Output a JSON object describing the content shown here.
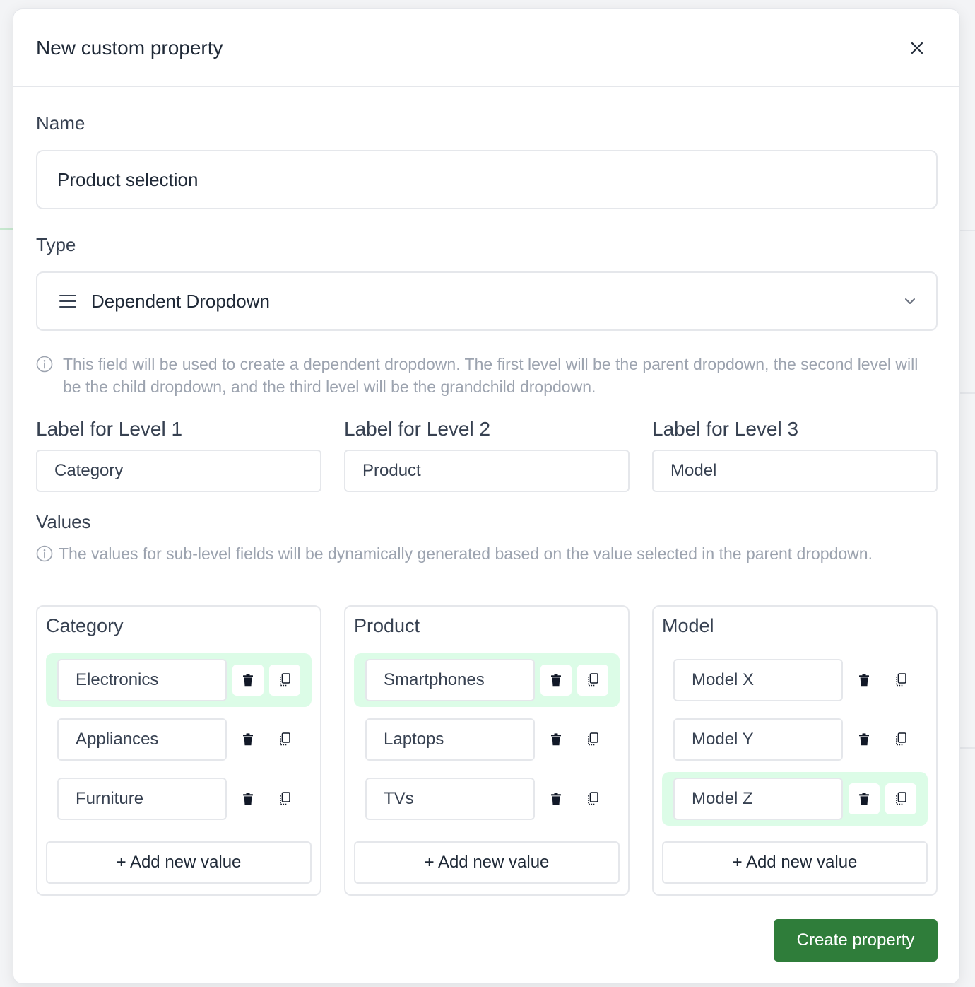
{
  "dialog": {
    "title": "New custom property",
    "create_label": "Create property"
  },
  "name_field": {
    "label": "Name",
    "value": "Product selection"
  },
  "type_field": {
    "label": "Type",
    "value": "Dependent Dropdown",
    "help": "This field will be used to create a dependent dropdown. The first level will be the parent dropdown, the second level will be the child dropdown, and the third level will be the grandchild dropdown."
  },
  "levels": [
    {
      "label": "Label for Level 1",
      "value": "Category"
    },
    {
      "label": "Label for Level 2",
      "value": "Product"
    },
    {
      "label": "Label for Level 3",
      "value": "Model"
    }
  ],
  "values_section": {
    "title": "Values",
    "help": "The values for sub-level fields will be dynamically generated based on the value selected in the parent dropdown.",
    "add_label": "+ Add new value"
  },
  "columns": [
    {
      "title": "Category",
      "selected_index": 0,
      "items": [
        "Electronics",
        "Appliances",
        "Furniture"
      ]
    },
    {
      "title": "Product",
      "selected_index": 0,
      "items": [
        "Smartphones",
        "Laptops",
        "TVs"
      ]
    },
    {
      "title": "Model",
      "selected_index": 2,
      "items": [
        "Model X",
        "Model Y",
        "Model Z"
      ]
    }
  ],
  "colors": {
    "accent": "#2f7d3a",
    "selected_row": "#dcfce7"
  }
}
